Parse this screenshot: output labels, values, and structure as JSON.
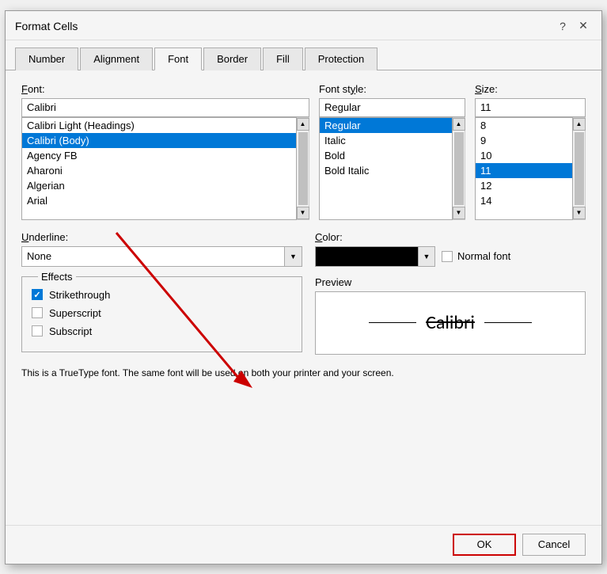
{
  "dialog": {
    "title": "Format Cells",
    "help_icon": "?",
    "close_icon": "✕"
  },
  "tabs": [
    {
      "label": "Number",
      "active": false
    },
    {
      "label": "Alignment",
      "active": false
    },
    {
      "label": "Font",
      "active": true
    },
    {
      "label": "Border",
      "active": false
    },
    {
      "label": "Fill",
      "active": false
    },
    {
      "label": "Protection",
      "active": false
    }
  ],
  "font_section": {
    "label": "Font:",
    "value": "Calibri",
    "items": [
      {
        "label": "Calibri Light (Headings)",
        "selected": false
      },
      {
        "label": "Calibri (Body)",
        "selected": true
      },
      {
        "label": "Agency FB",
        "selected": false
      },
      {
        "label": "Aharoni",
        "selected": false
      },
      {
        "label": "Algerian",
        "selected": false
      },
      {
        "label": "Arial",
        "selected": false
      }
    ]
  },
  "style_section": {
    "label": "Font style:",
    "value": "Regular",
    "items": [
      {
        "label": "Regular",
        "selected": true
      },
      {
        "label": "Italic",
        "selected": false
      },
      {
        "label": "Bold",
        "selected": false
      },
      {
        "label": "Bold Italic",
        "selected": false
      }
    ]
  },
  "size_section": {
    "label": "Size:",
    "value": "11",
    "items": [
      {
        "label": "8",
        "selected": false
      },
      {
        "label": "9",
        "selected": false
      },
      {
        "label": "10",
        "selected": false
      },
      {
        "label": "11",
        "selected": true
      },
      {
        "label": "12",
        "selected": false
      },
      {
        "label": "14",
        "selected": false
      }
    ]
  },
  "underline_section": {
    "label": "Underline:",
    "value": "None"
  },
  "color_section": {
    "label": "Color:",
    "normal_font_label": "Normal font"
  },
  "effects": {
    "legend": "Effects",
    "strikethrough": {
      "label": "Strikethrough",
      "checked": true
    },
    "superscript": {
      "label": "Superscript",
      "checked": false
    },
    "subscript": {
      "label": "Subscript",
      "checked": false
    }
  },
  "preview": {
    "label": "Preview",
    "text": "Calibri"
  },
  "info": {
    "text": "This is a TrueType font.  The same font will be used on both your printer and your screen."
  },
  "buttons": {
    "ok": "OK",
    "cancel": "Cancel"
  }
}
